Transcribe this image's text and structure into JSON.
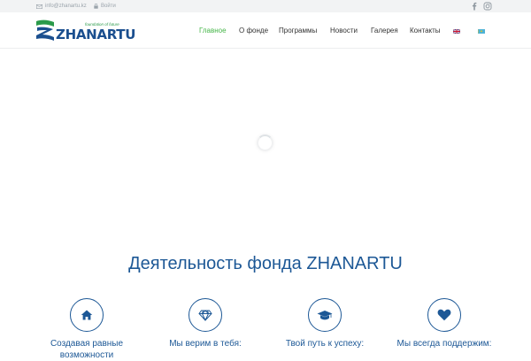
{
  "topbar": {
    "email": "info@zhanartu.kz",
    "login": "Войти",
    "icons": {
      "email": "envelope-icon",
      "login": "lock-icon",
      "social": [
        "facebook-icon",
        "instagram-icon"
      ]
    }
  },
  "logo": {
    "name": "ZHANARTU",
    "tagline": "foundation of future"
  },
  "nav": {
    "items": [
      {
        "label": "Главное",
        "active": true
      },
      {
        "label": "О фонде",
        "active": false
      },
      {
        "label": "Программы",
        "active": false
      },
      {
        "label": "Новости",
        "active": false
      },
      {
        "label": "Галерея",
        "active": false
      },
      {
        "label": "Контакты",
        "active": false
      }
    ],
    "languages": [
      {
        "lang": "en",
        "icon": "uk-flag-icon"
      },
      {
        "lang": "kz",
        "icon": "kazakhstan-flag-icon"
      }
    ]
  },
  "section": {
    "title": "Деятельность фонда ZHANARTU",
    "features": [
      {
        "icon": "home-icon",
        "label": "Создавая равные возможности"
      },
      {
        "icon": "diamond-icon",
        "label": "Мы верим в тебя:"
      },
      {
        "icon": "graduation-cap-icon",
        "label": "Твой путь к успеху:"
      },
      {
        "icon": "heart-icon",
        "label": "Мы всегда поддержим:"
      }
    ]
  },
  "colors": {
    "accent_green": "#46b649",
    "brand_blue": "#1d5896",
    "topbar_bg": "#f2f3f4"
  }
}
